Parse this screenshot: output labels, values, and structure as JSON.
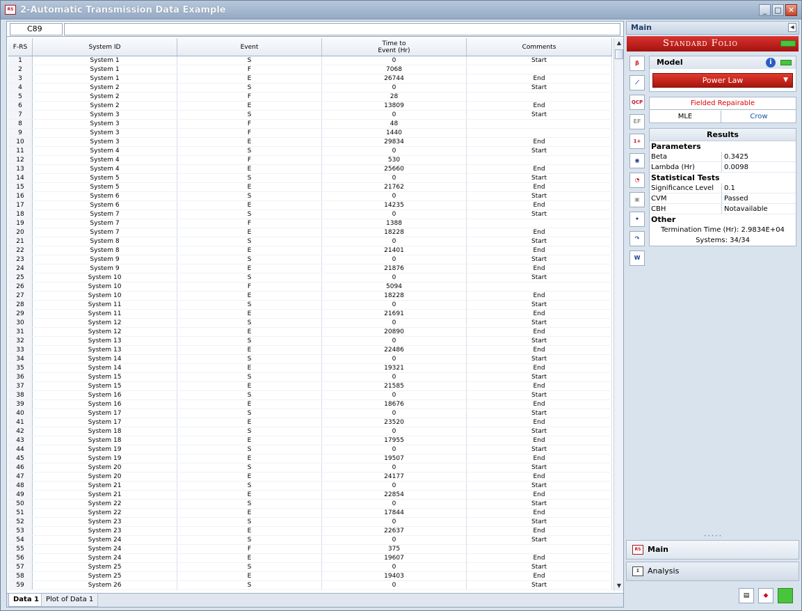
{
  "window": {
    "title": "2-Automatic Transmission Data Example",
    "app_icon": "RS"
  },
  "cell_bar": {
    "cell_ref": "C89",
    "formula": ""
  },
  "grid": {
    "headers": [
      "F-RS",
      "System ID",
      "Event",
      "Time to\nEvent (Hr)",
      "Comments"
    ],
    "rows": [
      [
        "1",
        "System 1",
        "S",
        "0",
        "Start"
      ],
      [
        "2",
        "System 1",
        "F",
        "7068",
        ""
      ],
      [
        "3",
        "System 1",
        "E",
        "26744",
        "End"
      ],
      [
        "4",
        "System 2",
        "S",
        "0",
        "Start"
      ],
      [
        "5",
        "System 2",
        "F",
        "28",
        ""
      ],
      [
        "6",
        "System 2",
        "E",
        "13809",
        "End"
      ],
      [
        "7",
        "System 3",
        "S",
        "0",
        "Start"
      ],
      [
        "8",
        "System 3",
        "F",
        "48",
        ""
      ],
      [
        "9",
        "System 3",
        "F",
        "1440",
        ""
      ],
      [
        "10",
        "System 3",
        "E",
        "29834",
        "End"
      ],
      [
        "11",
        "System 4",
        "S",
        "0",
        "Start"
      ],
      [
        "12",
        "System 4",
        "F",
        "530",
        ""
      ],
      [
        "13",
        "System 4",
        "E",
        "25660",
        "End"
      ],
      [
        "14",
        "System 5",
        "S",
        "0",
        "Start"
      ],
      [
        "15",
        "System 5",
        "E",
        "21762",
        "End"
      ],
      [
        "16",
        "System 6",
        "S",
        "0",
        "Start"
      ],
      [
        "17",
        "System 6",
        "E",
        "14235",
        "End"
      ],
      [
        "18",
        "System 7",
        "S",
        "0",
        "Start"
      ],
      [
        "19",
        "System 7",
        "F",
        "1388",
        ""
      ],
      [
        "20",
        "System 7",
        "E",
        "18228",
        "End"
      ],
      [
        "21",
        "System 8",
        "S",
        "0",
        "Start"
      ],
      [
        "22",
        "System 8",
        "E",
        "21401",
        "End"
      ],
      [
        "23",
        "System 9",
        "S",
        "0",
        "Start"
      ],
      [
        "24",
        "System 9",
        "E",
        "21876",
        "End"
      ],
      [
        "25",
        "System 10",
        "S",
        "0",
        "Start"
      ],
      [
        "26",
        "System 10",
        "F",
        "5094",
        ""
      ],
      [
        "27",
        "System 10",
        "E",
        "18228",
        "End"
      ],
      [
        "28",
        "System 11",
        "S",
        "0",
        "Start"
      ],
      [
        "29",
        "System 11",
        "E",
        "21691",
        "End"
      ],
      [
        "30",
        "System 12",
        "S",
        "0",
        "Start"
      ],
      [
        "31",
        "System 12",
        "E",
        "20890",
        "End"
      ],
      [
        "32",
        "System 13",
        "S",
        "0",
        "Start"
      ],
      [
        "33",
        "System 13",
        "E",
        "22486",
        "End"
      ],
      [
        "34",
        "System 14",
        "S",
        "0",
        "Start"
      ],
      [
        "35",
        "System 14",
        "E",
        "19321",
        "End"
      ],
      [
        "36",
        "System 15",
        "S",
        "0",
        "Start"
      ],
      [
        "37",
        "System 15",
        "E",
        "21585",
        "End"
      ],
      [
        "38",
        "System 16",
        "S",
        "0",
        "Start"
      ],
      [
        "39",
        "System 16",
        "E",
        "18676",
        "End"
      ],
      [
        "40",
        "System 17",
        "S",
        "0",
        "Start"
      ],
      [
        "41",
        "System 17",
        "E",
        "23520",
        "End"
      ],
      [
        "42",
        "System 18",
        "S",
        "0",
        "Start"
      ],
      [
        "43",
        "System 18",
        "E",
        "17955",
        "End"
      ],
      [
        "44",
        "System 19",
        "S",
        "0",
        "Start"
      ],
      [
        "45",
        "System 19",
        "E",
        "19507",
        "End"
      ],
      [
        "46",
        "System 20",
        "S",
        "0",
        "Start"
      ],
      [
        "47",
        "System 20",
        "E",
        "24177",
        "End"
      ],
      [
        "48",
        "System 21",
        "S",
        "0",
        "Start"
      ],
      [
        "49",
        "System 21",
        "E",
        "22854",
        "End"
      ],
      [
        "50",
        "System 22",
        "S",
        "0",
        "Start"
      ],
      [
        "51",
        "System 22",
        "E",
        "17844",
        "End"
      ],
      [
        "52",
        "System 23",
        "S",
        "0",
        "Start"
      ],
      [
        "53",
        "System 23",
        "E",
        "22637",
        "End"
      ],
      [
        "54",
        "System 24",
        "S",
        "0",
        "Start"
      ],
      [
        "55",
        "System 24",
        "F",
        "375",
        ""
      ],
      [
        "56",
        "System 24",
        "E",
        "19607",
        "End"
      ],
      [
        "57",
        "System 25",
        "S",
        "0",
        "Start"
      ],
      [
        "58",
        "System 25",
        "E",
        "19403",
        "End"
      ],
      [
        "59",
        "System 26",
        "S",
        "0",
        "Start"
      ]
    ]
  },
  "sheet_tabs": [
    "Data 1",
    "Plot of Data 1"
  ],
  "panel": {
    "header": "Main",
    "banner": "Standard Folio",
    "toolbar_icons": [
      "rs-icon",
      "plot-icon",
      "qcp-icon",
      "ef-icon",
      "calc-icon",
      "view-icon",
      "gauge-icon",
      "report-icon",
      "wizard-icon",
      "arrow-icon",
      "weibull-icon"
    ],
    "model_label": "Model",
    "model_value": "Power Law",
    "data_type": "Fielded Repairable",
    "method": "MLE",
    "submethod": "Crow",
    "results": {
      "title": "Results",
      "parameters_label": "Parameters",
      "params": [
        {
          "k": "Beta",
          "v": "0.3425"
        },
        {
          "k": "Lambda (Hr)",
          "v": "0.0098"
        }
      ],
      "stat_tests_label": "Statistical Tests",
      "tests": [
        {
          "k": "Significance Level",
          "v": "0.1"
        },
        {
          "k": "CVM",
          "v": "Passed"
        },
        {
          "k": "CBH",
          "v": "Notavailable"
        }
      ],
      "other_label": "Other",
      "termination": "Termination Time (Hr): 2.9834E+04",
      "systems": "Systems: 34/34"
    },
    "nav_main": "Main",
    "nav_analysis": "Analysis"
  },
  "colors": {
    "accent_red": "#c8102e",
    "accent_green": "#49c43d",
    "link_blue": "#1f4ea8"
  }
}
